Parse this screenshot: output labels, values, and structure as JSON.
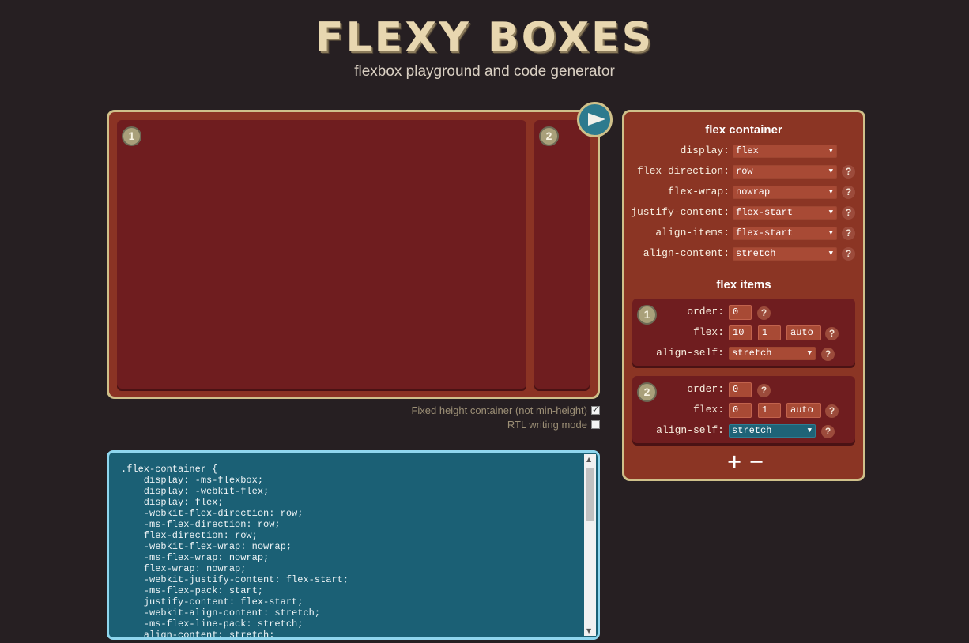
{
  "header": {
    "logo_text": "FLEXY BOXES",
    "subtitle": "flexbox playground and code generator"
  },
  "playground": {
    "items": [
      {
        "number": "1"
      },
      {
        "number": "2"
      }
    ],
    "options": {
      "fixed_height_label": "Fixed height container (not min-height)",
      "fixed_height_checked": true,
      "rtl_label": "RTL writing mode",
      "rtl_checked": false
    }
  },
  "code": {
    "text": ".flex-container {\n    display: -ms-flexbox;\n    display: -webkit-flex;\n    display: flex;\n    -webkit-flex-direction: row;\n    -ms-flex-direction: row;\n    flex-direction: row;\n    -webkit-flex-wrap: nowrap;\n    -ms-flex-wrap: nowrap;\n    flex-wrap: nowrap;\n    -webkit-justify-content: flex-start;\n    -ms-flex-pack: start;\n    justify-content: flex-start;\n    -webkit-align-content: stretch;\n    -ms-flex-line-pack: stretch;\n    align-content: stretch;"
  },
  "panel": {
    "container_heading": "flex container",
    "container_props": [
      {
        "label": "display:",
        "value": "flex",
        "help": false
      },
      {
        "label": "flex-direction:",
        "value": "row",
        "help": true
      },
      {
        "label": "flex-wrap:",
        "value": "nowrap",
        "help": true
      },
      {
        "label": "justify-content:",
        "value": "flex-start",
        "help": true
      },
      {
        "label": "align-items:",
        "value": "flex-start",
        "help": true
      },
      {
        "label": "align-content:",
        "value": "stretch",
        "help": true
      }
    ],
    "items_heading": "flex items",
    "items": [
      {
        "number": "1",
        "order_label": "order:",
        "order": "0",
        "flex_label": "flex:",
        "flex_grow": "10",
        "flex_shrink": "1",
        "flex_basis": "auto",
        "align_self_label": "align-self:",
        "align_self": "stretch"
      },
      {
        "number": "2",
        "order_label": "order:",
        "order": "0",
        "flex_label": "flex:",
        "flex_grow": "0",
        "flex_shrink": "1",
        "flex_basis": "auto",
        "align_self_label": "align-self:",
        "align_self": "stretch"
      }
    ],
    "add_label": "+",
    "remove_label": "−",
    "help_label": "?",
    "arrow_glyph": "▼"
  },
  "colors": {
    "background": "#261f22",
    "panel": "#8b3524",
    "item": "#6f1d1f",
    "border": "#cfc08a",
    "code_bg": "#1b6075",
    "accent": "#2d7a8e"
  },
  "icons": {
    "play": "play-icon",
    "checkbox": "checkbox-icon"
  }
}
